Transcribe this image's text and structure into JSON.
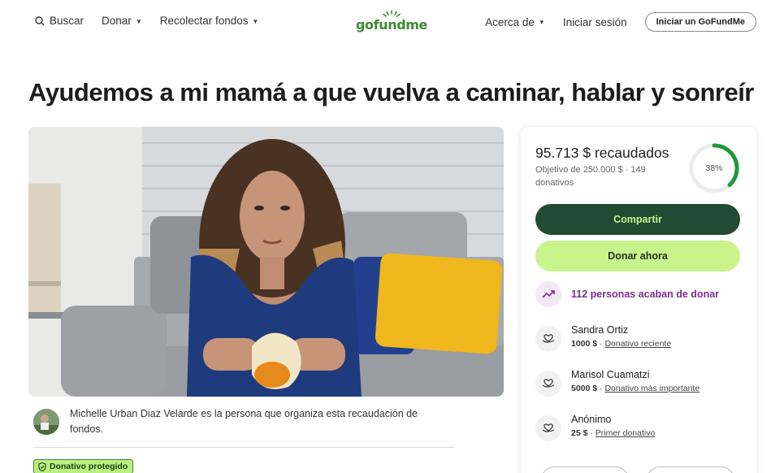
{
  "header": {
    "search_label": "Buscar",
    "donate_label": "Donar",
    "fundraise_label": "Recolectar fondos",
    "logo_text": "gofundme",
    "about_label": "Acerca de",
    "login_label": "Iniciar sesión",
    "start_label": "Iniciar un GoFundMe"
  },
  "campaign": {
    "title": "Ayudemos a mi mamá a que vuelva a caminar, hablar y sonreír",
    "organizer_text": "Michelle Urban Diaz Velarde es la persona que organiza esta recaudación de fondos.",
    "protected_badge": "Donativo protegido"
  },
  "donation_card": {
    "raised": "95.713 $ recaudados",
    "goal_text": "Objetivo de 250.000 $ · 149 donativos",
    "progress_fraction": 0.38,
    "progress_label": "38%",
    "share_label": "Compartir",
    "donate_now_label": "Donar ahora",
    "recent_text": "112 personas acaban de donar",
    "donors": [
      {
        "name": "Sandra Ortiz",
        "amount": "1000 $",
        "tag": "Donativo reciente"
      },
      {
        "name": "Marisol Cuamatzi",
        "amount": "5000 $",
        "tag": "Donativo más importante"
      },
      {
        "name": "Anónimo",
        "amount": "25 $",
        "tag": "Primer donativo"
      }
    ]
  },
  "colors": {
    "brand_green": "#3a8b2f",
    "share_bg": "#234a32",
    "lime": "#c9f38b",
    "purple": "#7a2d92",
    "ring_green": "#1f9a3a"
  },
  "icons": [
    "search-icon",
    "chevron-down-icon",
    "trend-up-icon",
    "heart-hand-icon",
    "shield-icon"
  ]
}
